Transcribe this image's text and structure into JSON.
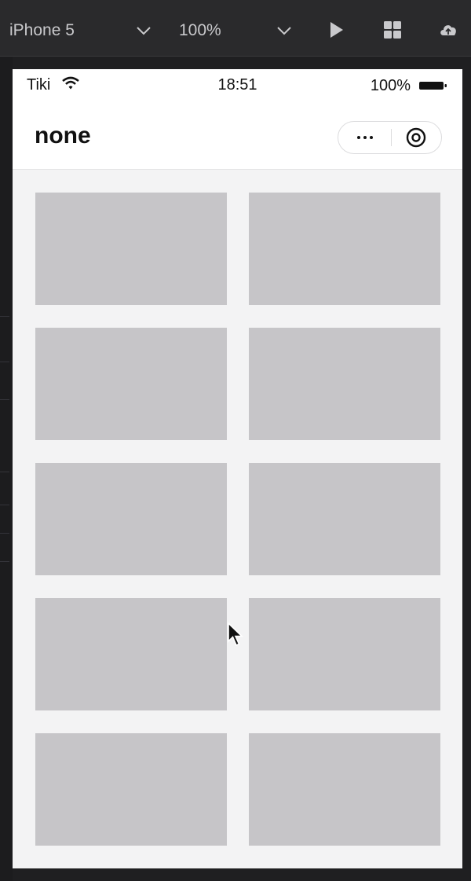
{
  "toolbar": {
    "device": "iPhone 5",
    "zoom": "100%",
    "icons": [
      "chevron-down-icon",
      "play-icon",
      "grid-icon",
      "cloud-upload-icon"
    ]
  },
  "status_bar": {
    "carrier": "Tiki",
    "time": "18:51",
    "battery": "100%"
  },
  "navbar": {
    "title": "none"
  },
  "grid": {
    "rows": 5,
    "columns": 2,
    "tile_color": "#c6c5c8"
  },
  "colors": {
    "screen_bg": "#f3f3f4",
    "toolbar_bg": "#2a2a2c"
  }
}
